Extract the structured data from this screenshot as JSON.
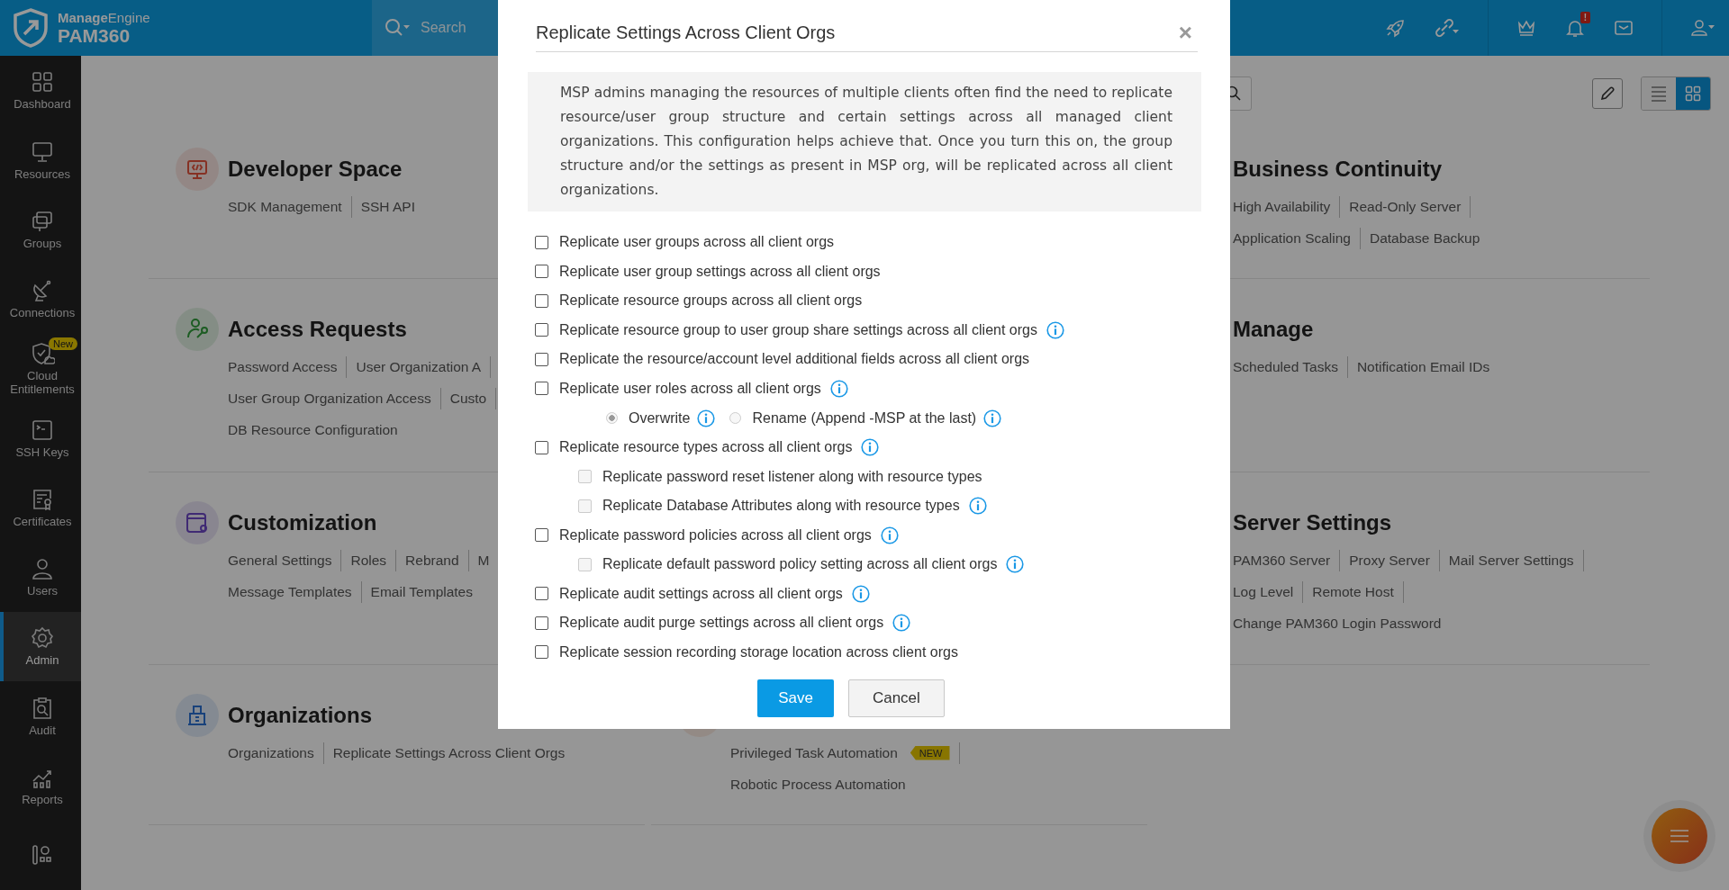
{
  "topbar": {
    "brand": "**Manage**Engine",
    "product": "PAM360",
    "search": {
      "placeholder": "Search"
    },
    "notification_badge": "!"
  },
  "sidebar": {
    "items": [
      {
        "label": "Dashboard",
        "selected": false
      },
      {
        "label": "Resources",
        "selected": false
      },
      {
        "label": "Groups",
        "selected": false
      },
      {
        "label": "Connections",
        "selected": false
      },
      {
        "label": "Cloud Entitlements",
        "selected": false,
        "badge": "New"
      },
      {
        "label": "SSH Keys",
        "selected": false
      },
      {
        "label": "Certificates",
        "selected": false
      },
      {
        "label": "Users",
        "selected": false
      },
      {
        "label": "Admin",
        "selected": true
      },
      {
        "label": "Audit",
        "selected": false
      },
      {
        "label": "Reports",
        "selected": false
      },
      {
        "selected": false
      }
    ]
  },
  "toolbar": {
    "views": [
      {
        "kind": "list",
        "selected": false
      },
      {
        "kind": "grid",
        "selected": true
      }
    ]
  },
  "columns": [
    {
      "sections": [
        {
          "title": "Developer Space",
          "lines": [
            [
              "SDK Management",
              "SSH API"
            ]
          ]
        },
        {
          "title": "Access Requests",
          "lines": [
            [
              "Password Access",
              "User Organization A"
            ],
            [
              "User Group Organization Access",
              "Custo"
            ],
            [
              "DB Resource Configuration"
            ]
          ]
        },
        {
          "title": "Customization",
          "lines": [
            [
              "General Settings",
              "Roles",
              "Rebrand",
              "M"
            ],
            [
              "Message Templates",
              "Email Templates"
            ]
          ]
        },
        {
          "title": "Organizations",
          "lines": [
            [
              "Organizations",
              "Replicate Settings Across Client Orgs"
            ]
          ]
        }
      ]
    },
    {
      "sections": [
        {
          "lines": [
            [
              {
                "label": "Privileged Task Automation",
                "badge": "NEW"
              }
            ],
            [
              "Robotic Process Automation"
            ]
          ]
        }
      ]
    },
    {
      "sections": [
        {
          "title": "Business Continuity",
          "lines": [
            [
              "High Availability",
              "Read-Only Server"
            ],
            [
              "Application Scaling",
              "Database Backup"
            ]
          ]
        },
        {
          "title": "Manage",
          "lines": [
            [
              "Scheduled Tasks",
              "Notification Email IDs"
            ]
          ]
        },
        {
          "title": "Server Settings",
          "lines": [
            [
              "PAM360 Server",
              "Proxy Server",
              "Mail Server Settings"
            ],
            [
              "Log Level",
              "Remote Host"
            ],
            [
              "Change PAM360 Login Password"
            ]
          ]
        }
      ]
    }
  ],
  "dialog": {
    "title": "Replicate Settings Across Client Orgs",
    "close": "×",
    "description": "MSP admins managing the resources of multiple clients often find the need to replicate resource/user group structure and certain settings across all managed client organizations. This configuration helps achieve that. Once you turn this on, the group structure and/or the settings as present in MSP org, will be replicated across all client organizations.",
    "options": [
      {
        "kind": "checkbox",
        "label": "Replicate user groups across all client orgs",
        "checked": false,
        "disabled": false,
        "info": false
      },
      {
        "kind": "checkbox",
        "label": "Replicate user group settings across all client orgs",
        "checked": false,
        "disabled": false,
        "info": false
      },
      {
        "kind": "checkbox",
        "label": "Replicate resource groups across all client orgs",
        "checked": false,
        "disabled": false,
        "info": false
      },
      {
        "kind": "checkbox",
        "label": "Replicate resource group to user group share settings across all client orgs",
        "checked": false,
        "disabled": false,
        "info": true
      },
      {
        "kind": "checkbox",
        "label": "Replicate the resource/account level additional fields across all client orgs",
        "checked": false,
        "disabled": false,
        "info": false
      },
      {
        "kind": "checkbox",
        "label": "Replicate user roles across all client orgs",
        "checked": false,
        "disabled": false,
        "info": true,
        "children": [
          {
            "kind": "radio",
            "label": "Overwrite",
            "selected": true,
            "disabled": true,
            "info": true
          },
          {
            "kind": "radio",
            "label": "Rename (Append -MSP at the last)",
            "selected": false,
            "disabled": true,
            "info": true
          }
        ]
      },
      {
        "kind": "checkbox",
        "label": "Replicate resource types across all client orgs",
        "checked": false,
        "disabled": false,
        "info": true,
        "children": [
          {
            "kind": "checkbox",
            "label": "Replicate password reset listener along with resource types",
            "checked": false,
            "disabled": true,
            "info": false
          },
          {
            "kind": "checkbox",
            "label": "Replicate Database Attributes along with resource types",
            "checked": false,
            "disabled": true,
            "info": true
          }
        ]
      },
      {
        "kind": "checkbox",
        "label": "Replicate password policies across all client orgs",
        "checked": false,
        "disabled": false,
        "info": true,
        "children": [
          {
            "kind": "checkbox",
            "label": "Replicate default password policy setting across all client orgs",
            "checked": false,
            "disabled": true,
            "info": true
          }
        ]
      },
      {
        "kind": "checkbox",
        "label": "Replicate audit settings across all client orgs",
        "checked": false,
        "disabled": false,
        "info": true
      },
      {
        "kind": "checkbox",
        "label": "Replicate audit purge settings across all client orgs",
        "checked": false,
        "disabled": false,
        "info": true
      },
      {
        "kind": "checkbox",
        "label": "Replicate session recording storage location across client orgs",
        "checked": false,
        "disabled": false,
        "info": false
      }
    ],
    "buttons": [
      {
        "label": "Save",
        "kind": "primary"
      },
      {
        "label": "Cancel",
        "kind": "secondary"
      }
    ]
  }
}
